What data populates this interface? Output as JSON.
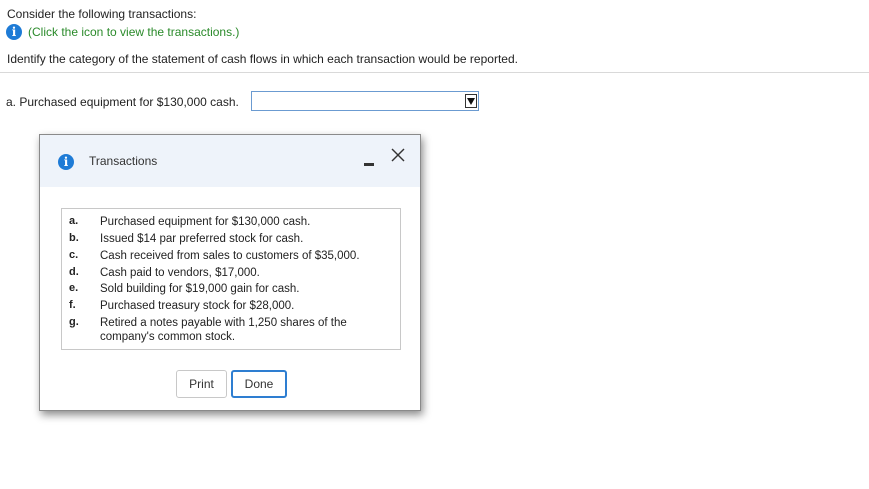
{
  "intro": "Consider the following transactions:",
  "info": {
    "icon": "info-icon",
    "link_text": "(Click the icon to view the transactions.)"
  },
  "instruction": "Identify the category of the statement of cash flows in which each transaction would be reported.",
  "question": {
    "label": "a. Purchased equipment for $130,000 cash.",
    "selected_value": ""
  },
  "modal": {
    "title": "Transactions",
    "transactions": [
      {
        "letter": "a.",
        "text": "Purchased equipment for $130,000 cash."
      },
      {
        "letter": "b.",
        "text": "Issued $14 par preferred stock for cash."
      },
      {
        "letter": "c.",
        "text": "Cash received from sales to customers of $35,000."
      },
      {
        "letter": "d.",
        "text": "Cash paid to vendors, $17,000."
      },
      {
        "letter": "e.",
        "text": "Sold building for $19,000 gain for cash."
      },
      {
        "letter": "f.",
        "text": "Purchased treasury stock for $28,000."
      },
      {
        "letter": "g.",
        "text": "Retired a notes payable with 1,250 shares of the company's common stock."
      }
    ],
    "print_label": "Print",
    "done_label": "Done"
  },
  "colors": {
    "info_badge": "#1e7bd6",
    "link": "#2a8a2a",
    "done_border": "#2e7ed1",
    "modal_header": "#eef3fa"
  }
}
